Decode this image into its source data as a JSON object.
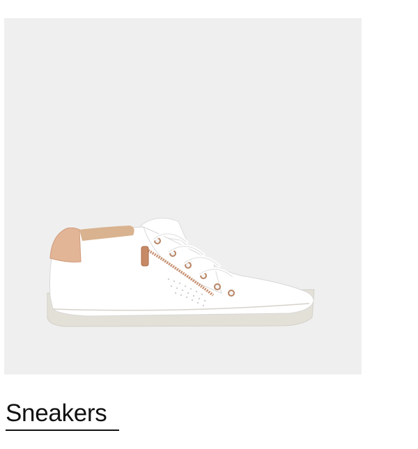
{
  "product": {
    "image_icon": "sneaker-image",
    "background_color": "#efefef",
    "shoe_color": "#ffffff",
    "accent_color": "#d9a98a",
    "sole_color": "#e3e0d8"
  },
  "category": {
    "label": "Sneakers"
  }
}
